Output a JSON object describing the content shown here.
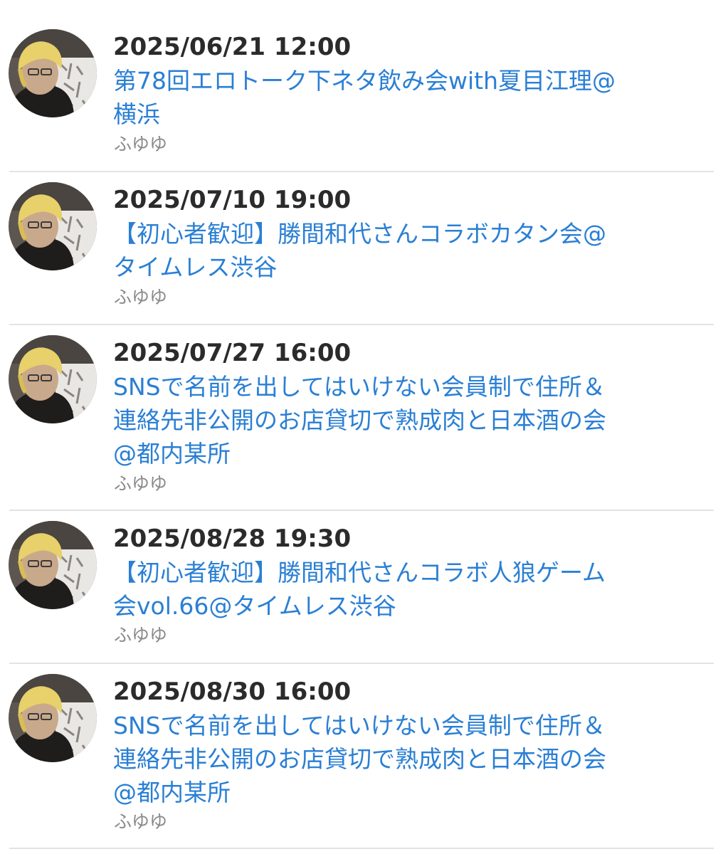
{
  "events": [
    {
      "datetime": "2025/06/21 12:00",
      "title_lines": [
        "第78回エロトーク下ネタ飲み会with夏目江理@",
        "横浜"
      ],
      "organizer": "ふゆゆ"
    },
    {
      "datetime": "2025/07/10 19:00",
      "title_lines": [
        "【初心者歓迎】勝間和代さんコラボカタン会@",
        "タイムレス渋谷"
      ],
      "organizer": "ふゆゆ"
    },
    {
      "datetime": "2025/07/27 16:00",
      "title_lines": [
        "SNSで名前を出してはいけない会員制で住所＆",
        "連絡先非公開のお店貸切で熟成肉と日本酒の会",
        "@都内某所"
      ],
      "organizer": "ふゆゆ"
    },
    {
      "datetime": "2025/08/28 19:30",
      "title_lines": [
        "【初心者歓迎】勝間和代さんコラボ人狼ゲーム",
        "会vol.66@タイムレス渋谷"
      ],
      "organizer": "ふゆゆ"
    },
    {
      "datetime": "2025/08/30 16:00",
      "title_lines": [
        "SNSで名前を出してはいけない会員制で住所＆",
        "連絡先非公開のお店貸切で熟成肉と日本酒の会",
        "@都内某所"
      ],
      "organizer": "ふゆゆ"
    }
  ],
  "colors": {
    "date": "#2b2b2b",
    "title_link": "#2a7fd4",
    "organizer": "#8a8a8a",
    "divider": "#e3e3e3"
  }
}
